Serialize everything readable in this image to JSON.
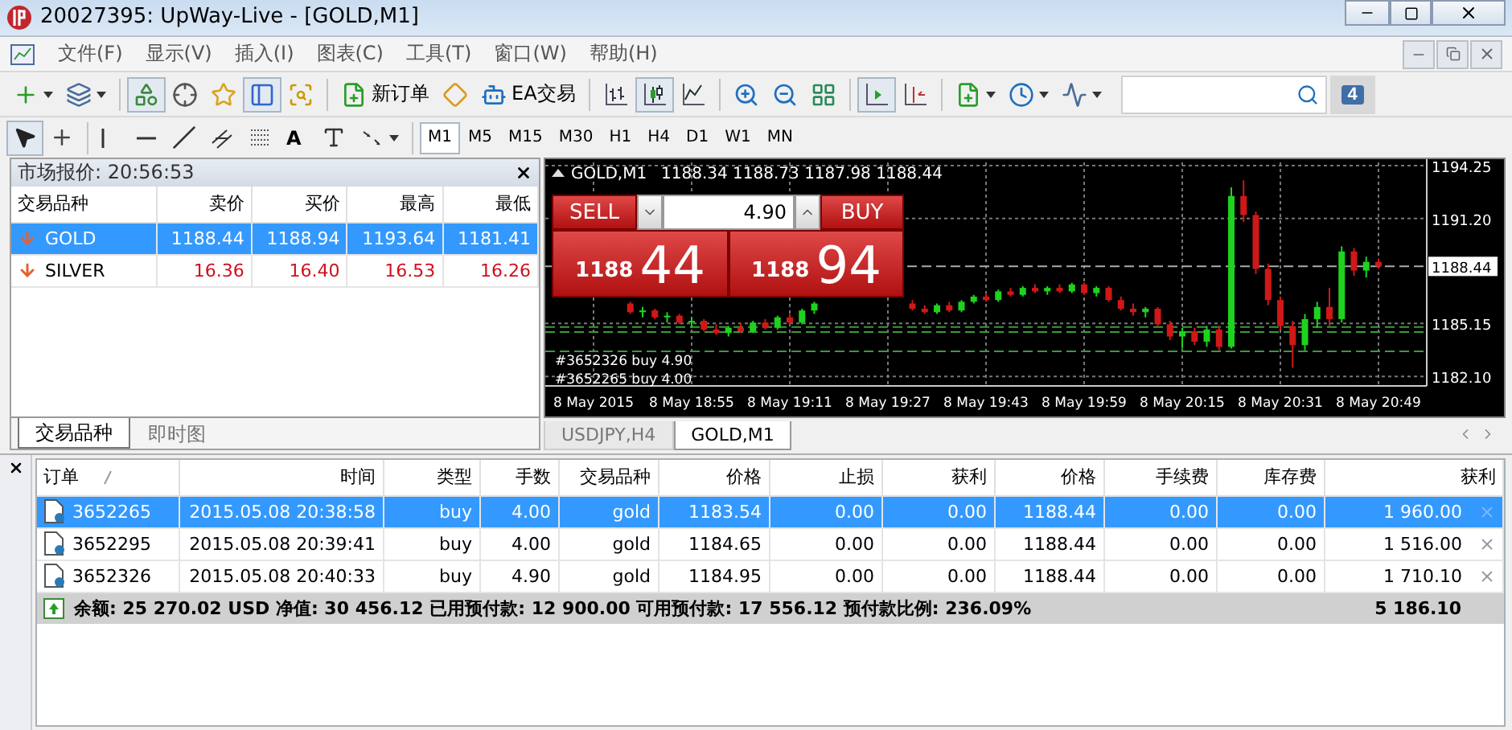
{
  "window": {
    "title": "20027395: UpWay-Live - [GOLD,M1]"
  },
  "menu": [
    "文件(F)",
    "显示(V)",
    "插入(I)",
    "图表(C)",
    "工具(T)",
    "窗口(W)",
    "帮助(H)"
  ],
  "toolbar": {
    "items": [
      {
        "kind": "icon",
        "pressed": false
      },
      {
        "kind": "icon",
        "pressed": false
      },
      {
        "kind": "separator"
      },
      {
        "kind": "icon",
        "pressed": true
      },
      {
        "kind": "icon",
        "pressed": false
      },
      {
        "kind": "icon",
        "pressed": false
      },
      {
        "kind": "icon",
        "pressed": true
      },
      {
        "kind": "icon",
        "pressed": false
      },
      {
        "kind": "separator"
      },
      {
        "kind": "button",
        "label": "新订单"
      },
      {
        "kind": "icon",
        "pressed": false
      },
      {
        "kind": "button",
        "label": "EA交易"
      },
      {
        "kind": "separator"
      },
      {
        "kind": "icon",
        "pressed": false
      },
      {
        "kind": "icon",
        "pressed": true
      },
      {
        "kind": "icon",
        "pressed": false
      },
      {
        "kind": "separator"
      },
      {
        "kind": "icon",
        "pressed": false
      },
      {
        "kind": "icon",
        "pressed": false
      },
      {
        "kind": "icon",
        "pressed": false
      },
      {
        "kind": "separator"
      },
      {
        "kind": "icon",
        "pressed": true
      },
      {
        "kind": "icon",
        "pressed": false
      },
      {
        "kind": "separator"
      },
      {
        "kind": "icon",
        "pressed": false
      },
      {
        "kind": "icon",
        "pressed": false
      },
      {
        "kind": "icon",
        "pressed": false
      }
    ]
  },
  "chat_badge": "4",
  "drawing_toolbar": {
    "items": [
      {
        "kind": "icon",
        "pressed": true
      },
      {
        "kind": "icon",
        "pressed": false
      },
      {
        "kind": "separator"
      },
      {
        "kind": "icon",
        "pressed": false
      },
      {
        "kind": "icon",
        "pressed": false
      },
      {
        "kind": "icon",
        "pressed": false
      },
      {
        "kind": "icon",
        "pressed": false
      },
      {
        "kind": "icon",
        "pressed": false
      },
      {
        "kind": "text",
        "label": "A"
      },
      {
        "kind": "icon",
        "pressed": false
      },
      {
        "kind": "icon",
        "pressed": false
      },
      {
        "kind": "separator"
      }
    ]
  },
  "timeframes": [
    {
      "label": "M1",
      "selected": true
    },
    {
      "label": "M5",
      "selected": false
    },
    {
      "label": "M15",
      "selected": false
    },
    {
      "label": "M30",
      "selected": false
    },
    {
      "label": "H1",
      "selected": false
    },
    {
      "label": "H4",
      "selected": false
    },
    {
      "label": "D1",
      "selected": false
    },
    {
      "label": "W1",
      "selected": false
    },
    {
      "label": "MN",
      "selected": false
    }
  ],
  "market_watch": {
    "title": "市场报价: 20:56:53",
    "columns": [
      "交易品种",
      "卖价",
      "买价",
      "最高",
      "最低"
    ],
    "rows": [
      {
        "symbol": "GOLD",
        "falling": true,
        "selected": true,
        "values": [
          "1188.44",
          "1188.94",
          "1193.64",
          "1181.41"
        ]
      },
      {
        "symbol": "SILVER",
        "falling": true,
        "selected": false,
        "values": [
          "16.36",
          "16.40",
          "16.53",
          "16.26"
        ]
      }
    ],
    "tabs": [
      {
        "label": "交易品种",
        "selected": true
      },
      {
        "label": "即时图",
        "selected": false
      }
    ]
  },
  "chart": {
    "symbol": "GOLD,M1",
    "ohlc": "1188.34 1188.73 1187.98 1188.44",
    "one_click": {
      "sell": "SELL",
      "buy": "BUY",
      "volume": "4.90",
      "sell_big": "1188",
      "sell_small": "44",
      "buy_big": "1188",
      "buy_small": "94"
    },
    "order_lines": [
      "#3652326 buy 4.90",
      "#3652265 buy 4.00"
    ],
    "current_price": "1188.44",
    "chart_data": {
      "type": "candlestick",
      "categories": [
        "8 May 2015",
        null,
        null,
        null,
        null,
        null,
        null,
        null,
        "8 May 18:55",
        null,
        null,
        null,
        null,
        null,
        null,
        null,
        "8 May 19:11",
        null,
        null,
        null,
        null,
        null,
        null,
        null,
        "8 May 19:27",
        null,
        null,
        null,
        null,
        null,
        null,
        null,
        "8 May 19:43",
        null,
        null,
        null,
        null,
        null,
        null,
        null,
        "8 May 19:59",
        null,
        null,
        null,
        null,
        null,
        null,
        null,
        "8 May 20:15",
        null,
        null,
        null,
        null,
        null,
        null,
        null,
        "8 May 20:31",
        null,
        null,
        null,
        null,
        null,
        null,
        null,
        "8 May 20:49"
      ],
      "ohlc": [
        null,
        null,
        null,
        [
          1186.3,
          1186.4,
          1185.7,
          1185.8
        ],
        [
          1185.8,
          1186.1,
          1185.5,
          1185.9
        ],
        [
          1185.9,
          1186.0,
          1185.4,
          1185.5
        ],
        [
          1185.5,
          1185.8,
          1185.2,
          1185.6
        ],
        [
          1185.6,
          1185.7,
          1185.1,
          1185.2
        ],
        [
          1185.2,
          1185.5,
          1184.9,
          1185.3
        ],
        [
          1185.3,
          1185.4,
          1184.7,
          1184.8
        ],
        [
          1184.8,
          1185.1,
          1184.5,
          1184.6
        ],
        [
          1184.6,
          1185.0,
          1184.4,
          1184.9
        ],
        [
          1184.9,
          1185.2,
          1184.6,
          1184.7
        ],
        [
          1184.7,
          1185.3,
          1184.6,
          1185.2
        ],
        [
          1185.2,
          1185.4,
          1184.8,
          1184.9
        ],
        [
          1184.9,
          1185.6,
          1184.8,
          1185.5
        ],
        [
          1185.5,
          1185.7,
          1185.1,
          1185.2
        ],
        [
          1185.2,
          1186.0,
          1185.1,
          1185.9
        ],
        [
          1185.9,
          1186.4,
          1185.7,
          1186.3
        ],
        null,
        null,
        null,
        null,
        null,
        null,
        null,
        [
          1186.3,
          1186.5,
          1185.9,
          1186.0
        ],
        [
          1186.0,
          1186.2,
          1185.7,
          1185.8
        ],
        [
          1185.8,
          1186.3,
          1185.7,
          1186.2
        ],
        [
          1186.2,
          1186.4,
          1185.8,
          1185.9
        ],
        [
          1185.9,
          1186.5,
          1185.8,
          1186.4
        ],
        [
          1186.4,
          1186.8,
          1186.3,
          1186.7
        ],
        [
          1186.7,
          1186.9,
          1186.4,
          1186.5
        ],
        [
          1186.5,
          1187.1,
          1186.4,
          1187.0
        ],
        [
          1187.0,
          1187.2,
          1186.7,
          1186.8
        ],
        [
          1186.8,
          1187.3,
          1186.7,
          1187.2
        ],
        [
          1187.2,
          1187.4,
          1186.9,
          1187.0
        ],
        [
          1187.0,
          1187.3,
          1186.8,
          1187.2
        ],
        [
          1187.2,
          1187.4,
          1186.9,
          1187.0
        ],
        [
          1187.0,
          1187.5,
          1186.9,
          1187.4
        ],
        [
          1187.4,
          1187.5,
          1186.8,
          1186.9
        ],
        [
          1186.9,
          1187.3,
          1186.7,
          1187.2
        ],
        [
          1187.2,
          1187.3,
          1186.4,
          1186.5
        ],
        [
          1186.5,
          1186.7,
          1185.9,
          1186.0
        ],
        [
          1186.0,
          1186.3,
          1185.6,
          1185.8
        ],
        [
          1185.8,
          1186.1,
          1185.5,
          1186.0
        ],
        [
          1186.0,
          1186.1,
          1185.0,
          1185.1
        ],
        [
          1185.1,
          1185.3,
          1184.2,
          1184.4
        ],
        [
          1184.4,
          1184.9,
          1183.7,
          1184.7
        ],
        [
          1184.7,
          1184.9,
          1183.9,
          1184.1
        ],
        [
          1184.1,
          1185.0,
          1183.8,
          1184.8
        ],
        [
          1184.8,
          1185.0,
          1183.6,
          1183.8
        ],
        [
          1183.8,
          1193.0,
          1183.7,
          1192.5
        ],
        [
          1192.5,
          1193.4,
          1191.0,
          1191.4
        ],
        [
          1191.4,
          1191.6,
          1188.0,
          1188.3
        ],
        [
          1188.3,
          1188.6,
          1186.2,
          1186.5
        ],
        [
          1186.5,
          1186.7,
          1184.8,
          1185.0
        ],
        [
          1185.0,
          1185.3,
          1182.6,
          1183.9
        ],
        [
          1183.9,
          1185.7,
          1183.6,
          1185.4
        ],
        [
          1185.4,
          1186.4,
          1184.9,
          1186.1
        ],
        [
          1186.1,
          1187.2,
          1185.0,
          1185.4
        ],
        [
          1185.4,
          1189.6,
          1185.2,
          1189.3
        ],
        [
          1189.3,
          1189.5,
          1187.9,
          1188.2
        ],
        [
          1188.2,
          1189.0,
          1187.8,
          1188.7
        ],
        [
          1188.7,
          1188.9,
          1188.3,
          1188.44
        ]
      ],
      "ylim": [
        1181.55,
        1194.62
      ],
      "grid": true,
      "ref_lines": [
        {
          "axis": "y",
          "value": 1184.95,
          "color": "#3a9a3a"
        },
        {
          "axis": "y",
          "value": 1184.65,
          "color": "#3a9a3a"
        },
        {
          "axis": "y",
          "value": 1183.54,
          "color": "#3a9a3a"
        },
        {
          "axis": "y",
          "value": 1188.44,
          "color": "#aaaaaa"
        }
      ],
      "yticks": [
        {
          "value": 1194.25,
          "label": "1194.25"
        },
        {
          "value": 1191.2,
          "label": "1191.20"
        },
        {
          "value": 1185.15,
          "label": "1185.15"
        },
        {
          "value": 1182.1,
          "label": "1182.10"
        }
      ]
    },
    "tabs": [
      {
        "label": "USDJPY,H4",
        "selected": false
      },
      {
        "label": "GOLD,M1",
        "selected": true
      }
    ]
  },
  "terminal": {
    "columns": [
      "订单",
      "时间",
      "类型",
      "手数",
      "交易品种",
      "价格",
      "止损",
      "获利",
      "价格",
      "手续费",
      "库存费",
      "获利"
    ],
    "rows": [
      {
        "selected": true,
        "cells": [
          "3652265",
          "2015.05.08 20:38:58",
          "buy",
          "4.00",
          "gold",
          "1183.54",
          "0.00",
          "0.00",
          "1188.44",
          "0.00",
          "0.00",
          "1 960.00"
        ]
      },
      {
        "selected": false,
        "cells": [
          "3652295",
          "2015.05.08 20:39:41",
          "buy",
          "4.00",
          "gold",
          "1184.65",
          "0.00",
          "0.00",
          "1188.44",
          "0.00",
          "0.00",
          "1 516.00"
        ]
      },
      {
        "selected": false,
        "cells": [
          "3652326",
          "2015.05.08 20:40:33",
          "buy",
          "4.90",
          "gold",
          "1184.95",
          "0.00",
          "0.00",
          "1188.44",
          "0.00",
          "0.00",
          "1 710.10"
        ]
      }
    ],
    "summary": "余额: 25 270.02 USD  净值: 30 456.12  已用预付款: 12 900.00  可用预付款: 17 556.12  预付款比例: 236.09%",
    "summary_profit": "5 186.10"
  }
}
